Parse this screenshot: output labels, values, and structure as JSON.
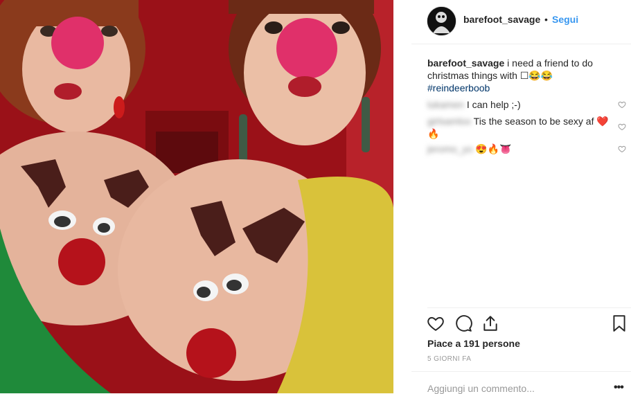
{
  "post": {
    "image_alt": "Photo of two women dressed as reindeer"
  },
  "header": {
    "username": "barefoot_savage",
    "dot": "•",
    "follow_label": "Segui"
  },
  "caption": {
    "username": "barefoot_savage",
    "text": "i need a friend to do christmas things with ☐😂😂",
    "hashtag": "#reindeerboob"
  },
  "comments": [
    {
      "username": "lukamen",
      "text": "I can help ;-)"
    },
    {
      "username": "girlsamlox",
      "text": "Tis the season to be sexy af ❤️🔥"
    },
    {
      "username": "jeromo_yo",
      "text": "😍🔥👅"
    }
  ],
  "actions": {
    "likes": "Piace a 191 persone",
    "date": "5 GIORNI FA"
  },
  "comment_box": {
    "placeholder": "Aggiungi un commento...",
    "more": "•••"
  },
  "colors": {
    "link": "#3897f0",
    "hashtag": "#003569",
    "muted": "#999999"
  }
}
